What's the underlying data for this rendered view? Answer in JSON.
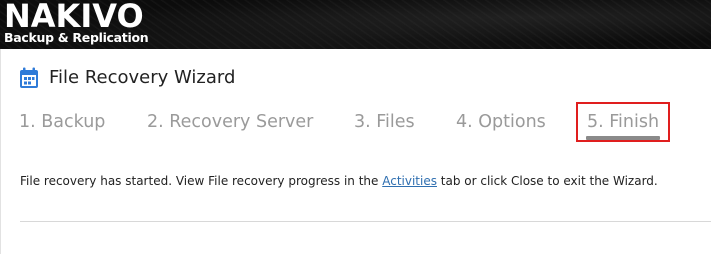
{
  "brand": {
    "name": "NAKIVO",
    "tagline": "Backup & Replication"
  },
  "wizard": {
    "title": "File Recovery Wizard",
    "icon": "calendar-icon",
    "steps": [
      {
        "label": "1. Backup",
        "state": "inactive"
      },
      {
        "label": "2. Recovery Server",
        "state": "inactive"
      },
      {
        "label": "3. Files",
        "state": "inactive"
      },
      {
        "label": "4. Options",
        "state": "inactive"
      },
      {
        "label": "5. Finish",
        "state": "active"
      }
    ],
    "message": {
      "before": "File recovery has started. View File recovery progress in the ",
      "link": "Activities",
      "after": " tab or click Close to exit the Wizard."
    }
  },
  "colors": {
    "header_bg": "#0c0c0c",
    "icon_blue": "#2f7bd8",
    "link": "#2f6fb0",
    "step_inactive": "#9a9a9a",
    "highlight_box": "#e01e1e"
  }
}
